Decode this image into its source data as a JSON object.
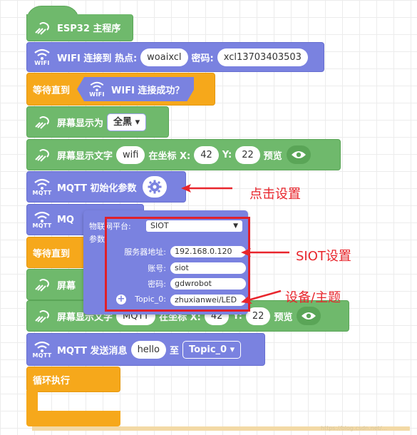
{
  "blocks": {
    "main": {
      "label": "ESP32 主程序"
    },
    "wifi_connect": {
      "icon_label": "WIFI",
      "prefix": "WIFI 连接到 热点:",
      "ssid": "woaixcl",
      "pwd_label": "密码:",
      "pwd": "xcl13703403503"
    },
    "wait_wifi": {
      "label": "等待直到",
      "icon_label": "WIFI",
      "condition": "WIFI 连接成功？"
    },
    "screen_show": {
      "label": "屏幕显示为",
      "value": "全黑"
    },
    "screen_text1": {
      "label": "屏幕显示文字",
      "text": "wifi",
      "coord_label": "在坐标 X:",
      "x": "42",
      "y_label": "Y:",
      "y": "22",
      "preview": "预览"
    },
    "mqtt_init": {
      "icon_label": "MQTT",
      "label": "MQTT 初始化参数"
    },
    "mqtt_partial": {
      "label": "MQ",
      "icon_label": "MQTT"
    },
    "wait_partial": {
      "label": "等待直到"
    },
    "screen_partial": {
      "label": "屏幕"
    },
    "screen_text2": {
      "label": "屏幕显示文字",
      "text": "MQTT",
      "coord_label": "在坐标 X:",
      "x": "42",
      "y_label": "Y:",
      "y": "22",
      "preview": "预览"
    },
    "mqtt_send": {
      "icon_label": "MQTT",
      "label": "MQTT 发送消息",
      "msg": "hello",
      "to_label": "至",
      "topic": "Topic_0"
    },
    "loop": {
      "label": "循环执行"
    }
  },
  "popup": {
    "platform_label": "物联网平台:",
    "platform_value": "SIOT",
    "params_label": "参数:",
    "server_label": "服务器地址:",
    "server_value": "192.168.0.120",
    "account_label": "账号:",
    "account_value": "siot",
    "password_label": "密码:",
    "password_value": "gdwrobot",
    "topic_label": "Topic_0:",
    "topic_value": "zhuxianwei/LED"
  },
  "annotations": {
    "click": "点击设置",
    "siot": "SIOT设置",
    "device": "设备/主题"
  },
  "watermark": "https://blog.csdn.net/...",
  "colors": {
    "green": "#6fb96c",
    "purple": "#7a82e0",
    "orange": "#f6a81b",
    "annotation_red": "#e8252c"
  }
}
